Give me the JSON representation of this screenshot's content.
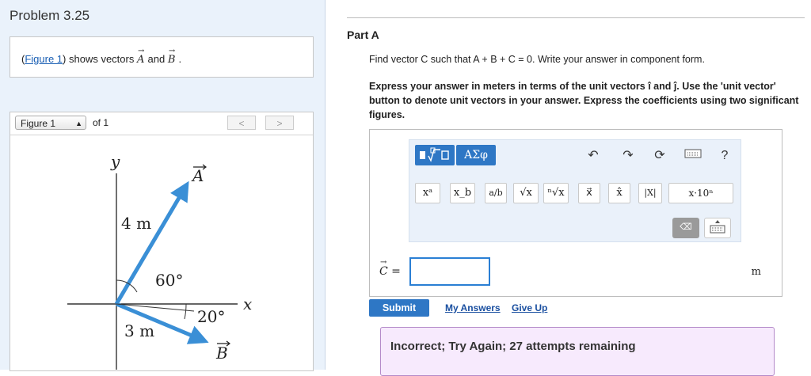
{
  "problem": {
    "title": "Problem 3.25",
    "figure_link": "Figure 1",
    "text_prefix": "(",
    "text_mid": ") shows vectors ",
    "vec_a": "A",
    "text_and": " and ",
    "vec_b": "B",
    "text_end": "."
  },
  "figure": {
    "selector_value": "Figure 1",
    "of_label": "of 1",
    "prev_icon": "chevron-left-icon",
    "next_icon": "chevron-right-icon",
    "labels": {
      "y": "y",
      "x": "x",
      "a": "A",
      "b": "B",
      "a_length": "4 m",
      "b_length": "3 m",
      "angle_a": "60°",
      "angle_b": "20°"
    },
    "colors": {
      "vector": "#3a8fd6",
      "axis": "#333333"
    }
  },
  "part": {
    "label": "Part A",
    "question": "Find vector C such that A + B + C = 0. Write your answer in component form.",
    "instructions": "Express your answer in meters in terms of the unit vectors î and ĵ. Use the 'unit vector' button to denote unit vectors in your answer. Express the coefficients using two significant figures."
  },
  "toolbar": {
    "greek_label": "ΑΣφ",
    "undo_icon": "undo-icon",
    "redo_icon": "redo-icon",
    "reset_icon": "reset-icon",
    "keyboard_icon": "keyboard-icon",
    "help_label": "?",
    "symbols": [
      "xᵃ",
      "x_b",
      "a/b",
      "√x",
      "ⁿ√x",
      "x⃗",
      "x̂",
      "|X|",
      "x·10ⁿ"
    ],
    "delete_icon": "backspace-icon"
  },
  "answer": {
    "c_label": "C =",
    "value": "",
    "unit": "m"
  },
  "actions": {
    "submit": "Submit",
    "my_answers": "My Answers",
    "give_up": "Give Up"
  },
  "feedback": {
    "message": "Incorrect; Try Again; 27 attempts remaining"
  }
}
